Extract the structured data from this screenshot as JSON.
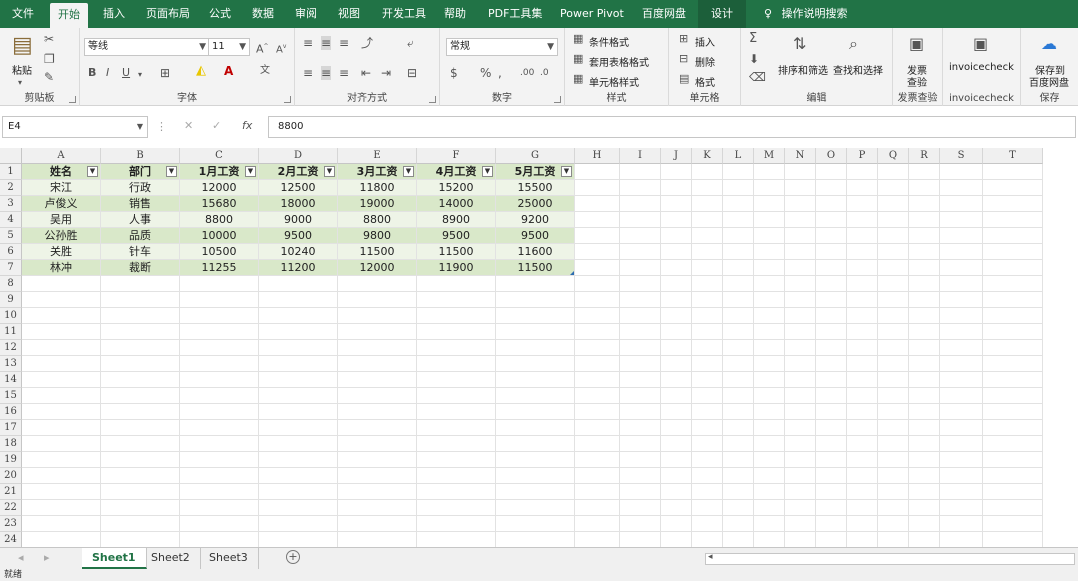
{
  "tabs": [
    {
      "label": "文件"
    },
    {
      "label": "开始"
    },
    {
      "label": "插入"
    },
    {
      "label": "页面布局"
    },
    {
      "label": "公式"
    },
    {
      "label": "数据"
    },
    {
      "label": "审阅"
    },
    {
      "label": "视图"
    },
    {
      "label": "开发工具"
    },
    {
      "label": "帮助"
    },
    {
      "label": "PDF工具集"
    },
    {
      "label": "Power Pivot"
    },
    {
      "label": "百度网盘"
    },
    {
      "label": "设计"
    }
  ],
  "tell_me": "操作说明搜索",
  "ribbon": {
    "clipboard": {
      "paste": "粘贴",
      "label": "剪贴板"
    },
    "font": {
      "name": "等线",
      "size": "11",
      "label": "字体"
    },
    "alignment": {
      "label": "对齐方式"
    },
    "number": {
      "format": "常规",
      "label": "数字"
    },
    "styles": {
      "conditional": "条件格式",
      "table_format": "套用表格格式",
      "cell_styles": "单元格样式",
      "label": "样式"
    },
    "cells": {
      "insert": "插入",
      "delete": "删除",
      "format": "格式",
      "label": "单元格"
    },
    "editing": {
      "sort": "排序和筛选",
      "find": "查找和选择",
      "label": "编辑"
    },
    "invoice": {
      "btn1": "发票",
      "btn2": "查验",
      "label": "发票查验"
    },
    "invoicecheck": {
      "btn": "invoicecheck",
      "label": "invoicecheck"
    },
    "save": {
      "btn1": "保存到",
      "btn2": "百度网盘",
      "label": "保存"
    }
  },
  "formula_bar": {
    "namebox": "E4",
    "fx": "fx",
    "value": "8800"
  },
  "columns": [
    "A",
    "B",
    "C",
    "D",
    "E",
    "F",
    "G",
    "H",
    "I",
    "J",
    "K",
    "L",
    "M",
    "N",
    "O",
    "P",
    "Q",
    "R",
    "S",
    "T"
  ],
  "rows": [
    "1",
    "2",
    "3",
    "4",
    "5",
    "6",
    "7",
    "8",
    "9",
    "10",
    "11",
    "12",
    "13",
    "14",
    "15",
    "16",
    "17",
    "18",
    "19",
    "20",
    "21",
    "22",
    "23",
    "24"
  ],
  "table": {
    "headers": [
      "姓名",
      "部门",
      "1月工资",
      "2月工资",
      "3月工资",
      "4月工资",
      "5月工资"
    ],
    "data": [
      [
        "宋江",
        "行政",
        "12000",
        "12500",
        "11800",
        "15200",
        "15500"
      ],
      [
        "卢俊义",
        "销售",
        "15680",
        "18000",
        "19000",
        "14000",
        "25000"
      ],
      [
        "吴用",
        "人事",
        "8800",
        "9000",
        "8800",
        "8900",
        "9200"
      ],
      [
        "公孙胜",
        "品质",
        "10000",
        "9500",
        "9800",
        "9500",
        "9500"
      ],
      [
        "关胜",
        "针车",
        "10500",
        "10240",
        "11500",
        "11500",
        "11600"
      ],
      [
        "林冲",
        "裁断",
        "11255",
        "11200",
        "12000",
        "11900",
        "11500"
      ]
    ]
  },
  "sheets": [
    {
      "label": "Sheet1"
    },
    {
      "label": "Sheet2"
    },
    {
      "label": "Sheet3"
    }
  ],
  "status": "就绪",
  "colors": {
    "accent": "#217346",
    "band_a": "#d9e8c9",
    "band_b": "#eef4e7"
  }
}
